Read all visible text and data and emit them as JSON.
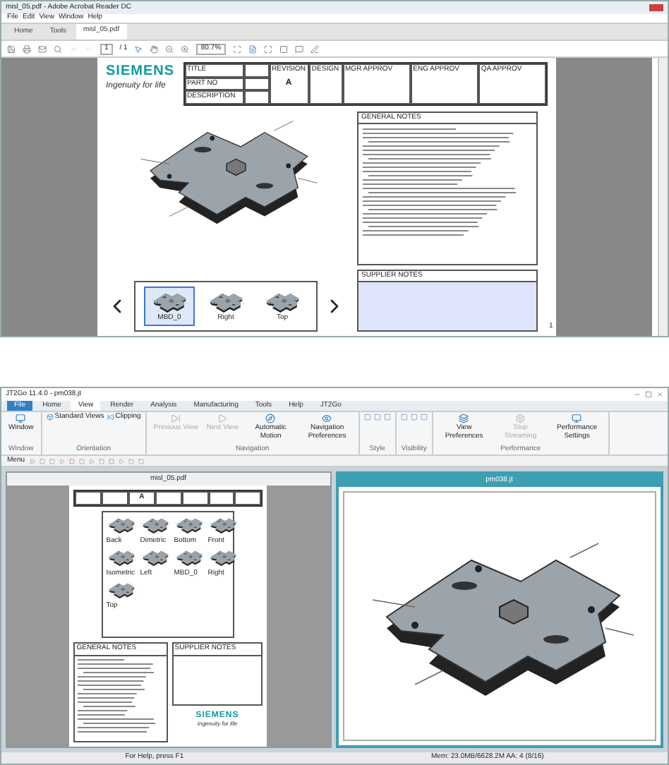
{
  "acrobat": {
    "title": "misl_05.pdf - Adobe Acrobat Reader DC",
    "menu": [
      "File",
      "Edit",
      "View",
      "Window",
      "Help"
    ],
    "tabs": [
      {
        "label": "Home",
        "selected": false
      },
      {
        "label": "Tools",
        "selected": false
      },
      {
        "label": "misl_05.pdf",
        "selected": true
      }
    ],
    "page_field": "1",
    "page_count": "/ 1",
    "zoom": "80.7%",
    "page": {
      "logo": "SIEMENS",
      "tagline": "Ingenuity for life",
      "title_block": [
        "TITLE",
        "PART NO",
        "DESCRIPTION"
      ],
      "columns": [
        "REVISION",
        "DESIGN",
        "MGR APPROV",
        "ENG APPROV",
        "QA APPROV"
      ],
      "revision": "A",
      "general_notes": "GENERAL NOTES",
      "supplier_notes": "SUPPLIER NOTES",
      "views": [
        {
          "label": "MBD_0",
          "selected": true
        },
        {
          "label": "Right",
          "selected": false
        },
        {
          "label": "Top",
          "selected": false
        }
      ],
      "page_number": "1"
    }
  },
  "jt2go": {
    "title": "JT2Go 11.4.0 - pm038.jt",
    "ribbon_tabs": [
      {
        "label": "File",
        "selected": false
      },
      {
        "label": "Home",
        "selected": false
      },
      {
        "label": "View",
        "selected": true
      },
      {
        "label": "Render",
        "selected": false
      },
      {
        "label": "Analysis",
        "selected": false
      },
      {
        "label": "Manufacturing",
        "selected": false
      },
      {
        "label": "Tools",
        "selected": false
      },
      {
        "label": "Help",
        "selected": false
      },
      {
        "label": "JT2Go",
        "selected": false
      }
    ],
    "groups": [
      {
        "label": "Window",
        "buttons": [
          {
            "label": "Window",
            "disabled": false
          }
        ]
      },
      {
        "label": "Orientation",
        "buttons": [
          {
            "label": "Standard Views",
            "disabled": false
          },
          {
            "label": "Clipping",
            "disabled": false
          }
        ]
      },
      {
        "label": "Navigation",
        "buttons": [
          {
            "label": "Previous View",
            "disabled": true
          },
          {
            "label": "Next View",
            "disabled": true
          },
          {
            "label": "Automatic Motion",
            "disabled": false
          },
          {
            "label": "Navigation Preferences",
            "disabled": false
          }
        ]
      },
      {
        "label": "Style"
      },
      {
        "label": "Visibility"
      },
      {
        "label": "Performance",
        "buttons": [
          {
            "label": "View Preferences",
            "disabled": false
          },
          {
            "label": "Stop Streaming",
            "disabled": true
          },
          {
            "label": "Performance Settings",
            "disabled": false
          }
        ]
      }
    ],
    "menu_button": "Menu",
    "pdf_window": {
      "title": "misl_05.pdf",
      "revision": "A",
      "logo": "SIEMENS",
      "tagline": "Ingenuity for life",
      "general_notes": "GENERAL NOTES",
      "supplier_notes": "SUPPLIER NOTES",
      "views": [
        "Back",
        "Dimetric",
        "Bottom",
        "Front",
        "Isometric",
        "Left",
        "MBD_0",
        "Right",
        "Top"
      ]
    },
    "model_window": {
      "title": "pm038.jt"
    },
    "status": [
      "For Help, press F1",
      "Mem: 23.0MB/6628.2M AA: 4 (8/16)"
    ]
  }
}
